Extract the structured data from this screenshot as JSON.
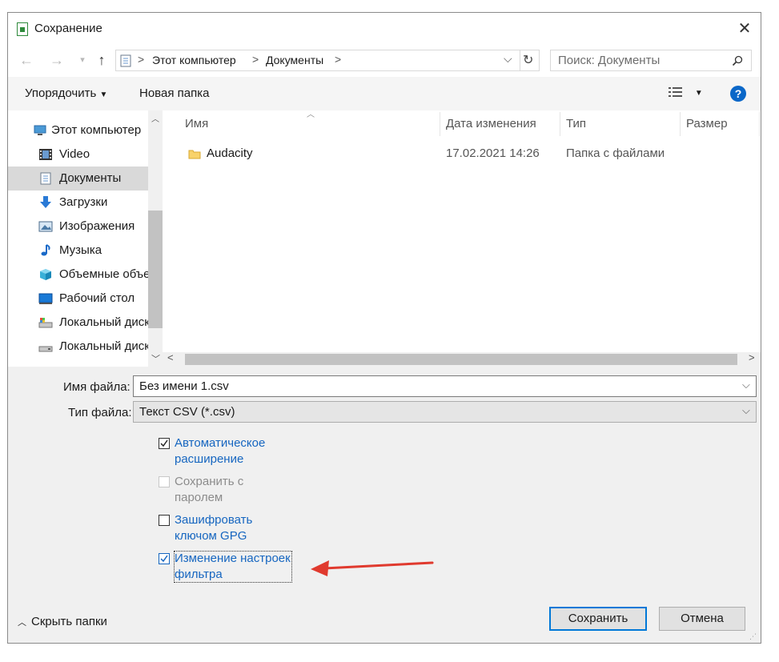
{
  "window": {
    "title": "Сохранение"
  },
  "address": {
    "computer": "Этот компьютер",
    "folder": "Документы",
    "search_placeholder": "Поиск: Документы"
  },
  "toolbar": {
    "organize": "Упорядочить",
    "new_folder": "Новая папка",
    "help": "?"
  },
  "sidebar": {
    "items": [
      {
        "label": "Этот компьютер",
        "icon": "computer-icon"
      },
      {
        "label": "Video",
        "icon": "video-icon"
      },
      {
        "label": "Документы",
        "icon": "documents-icon",
        "selected": true
      },
      {
        "label": "Загрузки",
        "icon": "downloads-icon"
      },
      {
        "label": "Изображения",
        "icon": "pictures-icon"
      },
      {
        "label": "Музыка",
        "icon": "music-icon"
      },
      {
        "label": "Объемные объекты",
        "icon": "3d-objects-icon"
      },
      {
        "label": "Рабочий стол",
        "icon": "desktop-icon"
      },
      {
        "label": "Локальный диск",
        "icon": "local-disk-icon"
      },
      {
        "label": "Локальный диск",
        "icon": "local-disk-icon"
      }
    ]
  },
  "columns": {
    "name": "Имя",
    "date": "Дата изменения",
    "type": "Тип",
    "size": "Размер"
  },
  "files": [
    {
      "name": "Audacity",
      "date": "17.02.2021 14:26",
      "type": "Папка с файлами"
    }
  ],
  "form": {
    "filename_label": "Имя файла:",
    "filename_value": "Без имени 1.csv",
    "filetype_label": "Тип файла:",
    "filetype_value": "Текст CSV (*.csv)"
  },
  "options": [
    {
      "line1": "Автоматическое",
      "line2": "расширение",
      "checked": true,
      "disabled": false
    },
    {
      "line1": "Сохранить с",
      "line2": "паролем",
      "checked": false,
      "disabled": true
    },
    {
      "line1": "Зашифровать",
      "line2": "ключом GPG",
      "checked": false,
      "disabled": false
    },
    {
      "line1": "Изменение настроек",
      "line2": "фильтра",
      "checked": true,
      "disabled": false
    }
  ],
  "footer": {
    "hide_folders": "Скрыть папки",
    "save": "Сохранить",
    "cancel": "Отмена"
  },
  "colors": {
    "accent": "#0078d7",
    "link": "#1666c0",
    "annotation_arrow": "#e03a2e"
  }
}
